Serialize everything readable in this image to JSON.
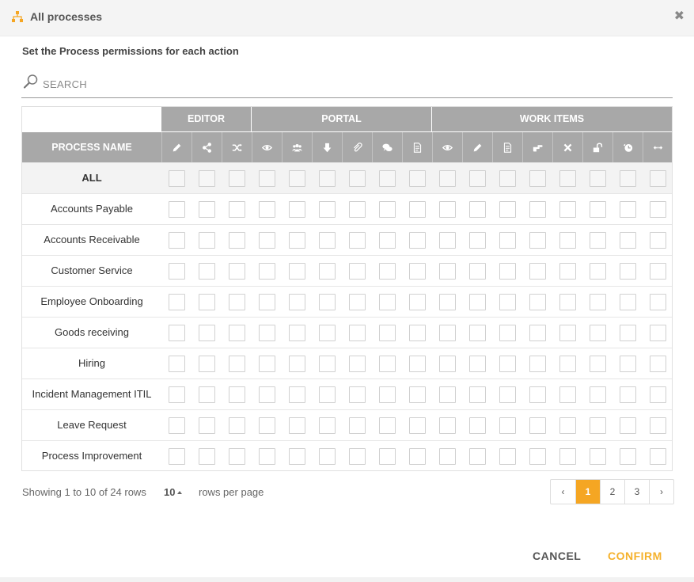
{
  "header": {
    "title": "All processes",
    "logo_icon": "process-hierarchy-icon",
    "close_icon": "close-x-icon"
  },
  "subtitle": "Set the Process permissions for each action",
  "search": {
    "placeholder": "SEARCH",
    "value": "",
    "icon": "search-magnifier-icon"
  },
  "table": {
    "groups": [
      {
        "label": "EDITOR"
      },
      {
        "label": "PORTAL"
      },
      {
        "label": "WORK ITEMS"
      }
    ],
    "name_header": "PROCESS NAME",
    "column_icons": [
      "edit-pencil-icon",
      "share-icon",
      "shuffle-icon",
      "view-eye-icon",
      "users-group-icon",
      "download-arrow-icon",
      "attachment-icon",
      "comments-icon",
      "document-list-icon",
      "view-eye-icon",
      "edit-pencil-icon",
      "document-list-icon",
      "hand-point-icon",
      "close-x-icon",
      "unlock-icon",
      "clock-history-icon",
      "arrows-horizontal-icon"
    ],
    "all_row_label": "ALL",
    "rows": [
      "Accounts Payable",
      "Accounts Receivable",
      "Customer Service",
      "Employee Onboarding",
      "Goods receiving",
      "Hiring",
      "Incident Management ITIL",
      "Leave Request",
      "Process Improvement"
    ]
  },
  "footer": {
    "showing_text": "Showing 1 to 10 of 24 rows",
    "page_size": "10",
    "rows_per_page": "rows per page",
    "pagination": {
      "prev": "‹",
      "pages": [
        "1",
        "2",
        "3"
      ],
      "active": "1",
      "next": "›"
    }
  },
  "actions": {
    "cancel": "CANCEL",
    "confirm": "CONFIRM"
  },
  "colors": {
    "accent": "#f5a623",
    "header_gray": "#a8a8a8"
  }
}
